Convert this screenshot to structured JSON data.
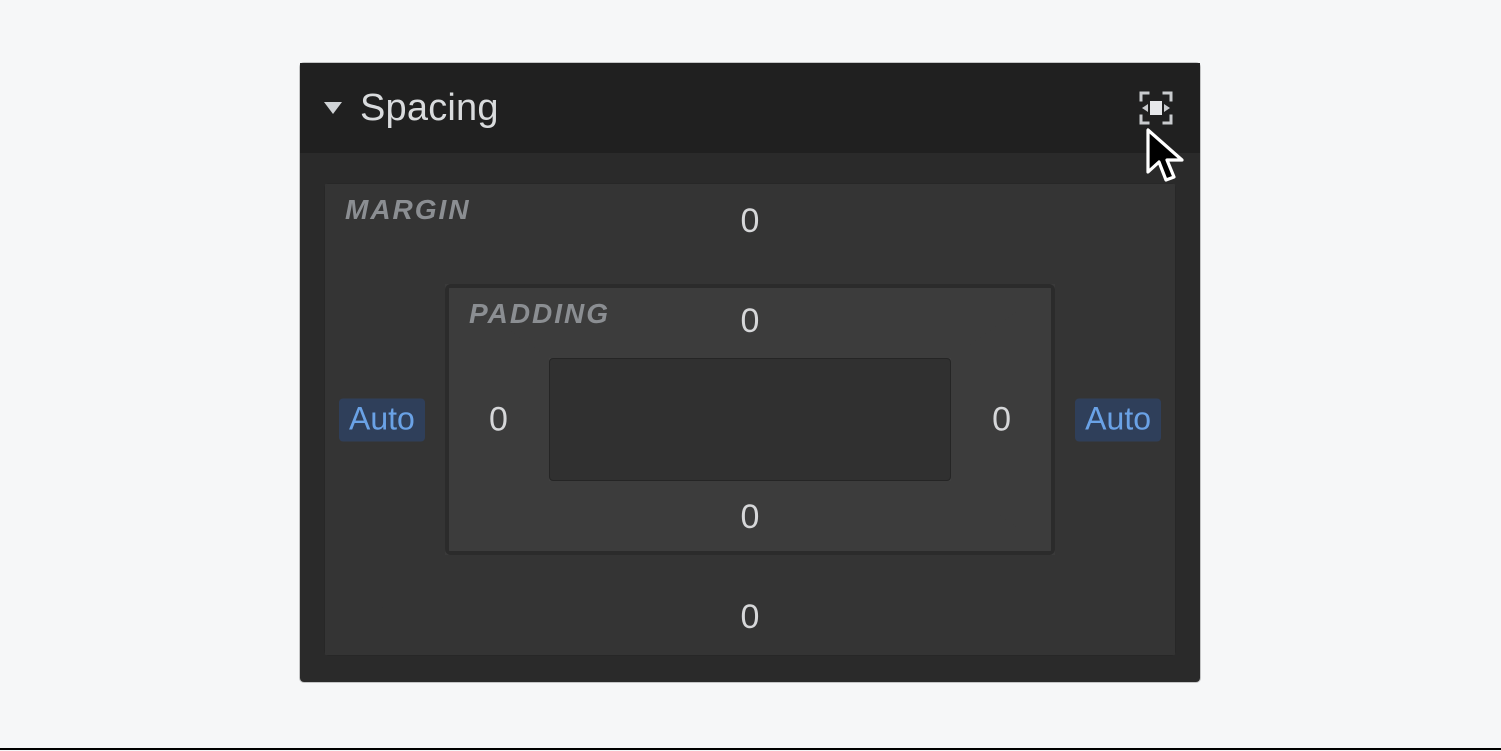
{
  "header": {
    "title": "Spacing"
  },
  "labels": {
    "margin": "MARGIN",
    "padding": "PADDING"
  },
  "margin": {
    "top": "0",
    "bottom": "0",
    "left": "Auto",
    "right": "Auto"
  },
  "padding": {
    "top": "0",
    "right": "0",
    "bottom": "0",
    "left": "0"
  },
  "colors": {
    "panel_bg": "#2a2a2a",
    "header_bg": "#202020",
    "box_bg": "#3a3a3a",
    "auto_chip_bg": "#2f3f5a",
    "auto_chip_text": "#6aa2e6",
    "text_muted": "#8b8e92",
    "text": "#d6d7d9"
  }
}
